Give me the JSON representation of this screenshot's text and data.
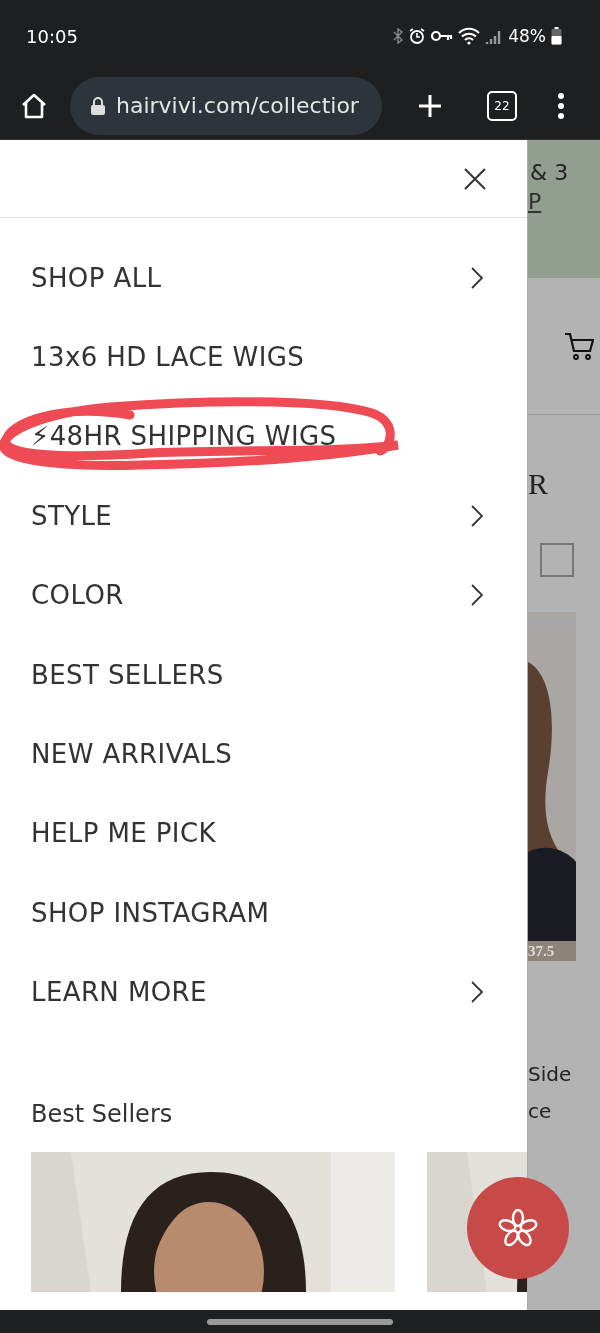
{
  "status_bar": {
    "time": "10:05",
    "battery": "48%"
  },
  "browser": {
    "url": "hairvivi.com/collectior",
    "tab_count": "22"
  },
  "menu": {
    "items": [
      {
        "label": "SHOP ALL",
        "has_submenu": true,
        "circled": false
      },
      {
        "label": "13x6 HD LACE WIGS",
        "has_submenu": false,
        "circled": false
      },
      {
        "label": "⚡48HR SHIPPING WIGS",
        "has_submenu": false,
        "circled": true
      },
      {
        "label": "STYLE",
        "has_submenu": true,
        "circled": false
      },
      {
        "label": "COLOR",
        "has_submenu": true,
        "circled": false
      },
      {
        "label": "BEST SELLERS",
        "has_submenu": false,
        "circled": false
      },
      {
        "label": "NEW ARRIVALS",
        "has_submenu": false,
        "circled": false
      },
      {
        "label": "HELP ME PICK",
        "has_submenu": false,
        "circled": false
      },
      {
        "label": "SHOP INSTAGRAM",
        "has_submenu": false,
        "circled": false
      },
      {
        "label": "LEARN MORE",
        "has_submenu": true,
        "circled": false
      }
    ],
    "section_title": "Best Sellers"
  },
  "background_page": {
    "checkbox_checked": false,
    "banner_text": "& 3",
    "banner_link": "P",
    "heading_fragment": "R",
    "price_fragment": "37.5",
    "title_fragments": [
      "Side",
      "ce"
    ]
  }
}
